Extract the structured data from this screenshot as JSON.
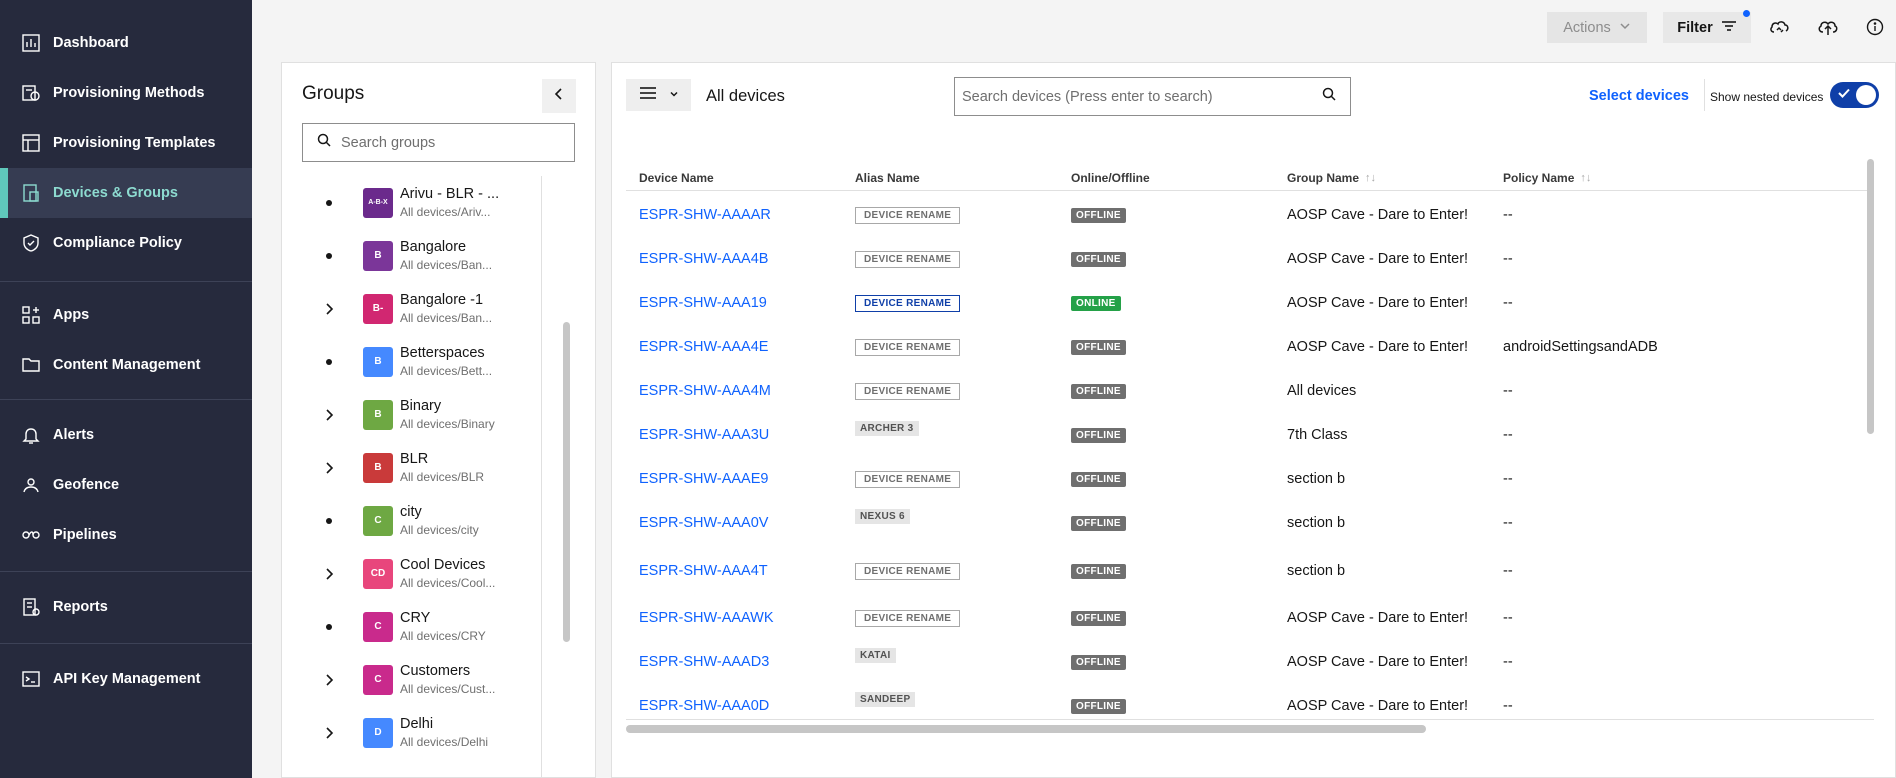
{
  "sidebar": {
    "items": [
      {
        "label": "Dashboard",
        "icon": "dashboard-icon"
      },
      {
        "label": "Provisioning Methods",
        "icon": "provisioning-methods-icon"
      },
      {
        "label": "Provisioning Templates",
        "icon": "provisioning-templates-icon"
      },
      {
        "label": "Devices & Groups",
        "icon": "devices-groups-icon",
        "active": true
      },
      {
        "label": "Compliance Policy",
        "icon": "compliance-shield-icon"
      },
      {
        "label": "Apps",
        "icon": "apps-icon"
      },
      {
        "label": "Content Management",
        "icon": "folder-icon"
      },
      {
        "label": "Alerts",
        "icon": "bell-icon"
      },
      {
        "label": "Geofence",
        "icon": "geofence-icon"
      },
      {
        "label": "Pipelines",
        "icon": "pipelines-icon"
      },
      {
        "label": "Reports",
        "icon": "reports-icon"
      },
      {
        "label": "API Key Management",
        "icon": "terminal-icon"
      }
    ],
    "accent_color": "#5fc8bb",
    "bg_color": "#262a3d"
  },
  "topbar": {
    "actions_label": "Actions",
    "filter_label": "Filter"
  },
  "groups": {
    "title": "Groups",
    "search_placeholder": "Search groups",
    "items": [
      {
        "name": "Arivu - BLR - ...",
        "path": "All devices/Ariv...",
        "avatar": "A-B-X",
        "color": "#6b2a8c",
        "expandable": false
      },
      {
        "name": "Bangalore",
        "path": "All devices/Ban...",
        "avatar": "B",
        "color": "#7b3699",
        "expandable": false
      },
      {
        "name": "Bangalore -1",
        "path": "All devices/Ban...",
        "avatar": "B-",
        "color": "#d12771",
        "expandable": true
      },
      {
        "name": "Betterspaces",
        "path": "All devices/Bett...",
        "avatar": "B",
        "color": "#4589ff",
        "expandable": false
      },
      {
        "name": "Binary",
        "path": "All devices/Binary",
        "avatar": "B",
        "color": "#6ea843",
        "expandable": true
      },
      {
        "name": "BLR",
        "path": "All devices/BLR",
        "avatar": "B",
        "color": "#c93a3a",
        "expandable": true
      },
      {
        "name": "city",
        "path": "All devices/city",
        "avatar": "C",
        "color": "#6ea843",
        "expandable": false
      },
      {
        "name": "Cool Devices",
        "path": "All devices/Cool...",
        "avatar": "CD",
        "color": "#e8467c",
        "expandable": true
      },
      {
        "name": "CRY",
        "path": "All devices/CRY",
        "avatar": "C",
        "color": "#c92a8c",
        "expandable": false
      },
      {
        "name": "Customers",
        "path": "All devices/Cust...",
        "avatar": "C",
        "color": "#c92a8c",
        "expandable": true
      },
      {
        "name": "Delhi",
        "path": "All devices/Delhi",
        "avatar": "D",
        "color": "#4589ff",
        "expandable": true
      }
    ]
  },
  "devices": {
    "title": "All devices",
    "search_placeholder": "Search devices (Press enter to search)",
    "select_label": "Select devices",
    "nested_label": "Show nested devices",
    "columns": [
      "Device Name",
      "Alias Name",
      "Online/Offline",
      "Group Name",
      "Policy Name"
    ],
    "rows": [
      {
        "name": "ESPR-SHW-AAAAR",
        "alias": "DEVICE RENAME",
        "alias_style": "tag",
        "status": "OFFLINE",
        "group": "AOSP Cave - Dare to Enter!",
        "policy": "--"
      },
      {
        "name": "ESPR-SHW-AAA4B",
        "alias": "DEVICE RENAME",
        "alias_style": "tag",
        "status": "OFFLINE",
        "group": "AOSP Cave - Dare to Enter!",
        "policy": "--"
      },
      {
        "name": "ESPR-SHW-AAA19",
        "alias": "DEVICE RENAME",
        "alias_style": "tag-hl",
        "status": "ONLINE",
        "group": "AOSP Cave - Dare to Enter!",
        "policy": "--"
      },
      {
        "name": "ESPR-SHW-AAA4E",
        "alias": "DEVICE RENAME",
        "alias_style": "tag",
        "status": "OFFLINE",
        "group": "AOSP Cave - Dare to Enter!",
        "policy": "androidSettingsandADB"
      },
      {
        "name": "ESPR-SHW-AAA4M",
        "alias": "DEVICE RENAME",
        "alias_style": "tag",
        "status": "OFFLINE",
        "group": "All devices",
        "policy": "--"
      },
      {
        "name": "ESPR-SHW-AAA3U",
        "alias": "ARCHER 3",
        "alias_style": "plain",
        "status": "OFFLINE",
        "group": "7th Class",
        "policy": "--"
      },
      {
        "name": "ESPR-SHW-AAAE9",
        "alias": "DEVICE RENAME",
        "alias_style": "tag",
        "status": "OFFLINE",
        "group": "section b",
        "policy": "--"
      },
      {
        "name": "ESPR-SHW-AAA0V",
        "alias": "NEXUS 6",
        "alias_style": "plain",
        "status": "OFFLINE",
        "group": "section b",
        "policy": "--"
      },
      {
        "name": "ESPR-SHW-AAA4T",
        "alias": "DEVICE RENAME",
        "alias_style": "tag",
        "status": "OFFLINE",
        "group": "section b",
        "policy": "--"
      },
      {
        "name": "ESPR-SHW-AAAWK",
        "alias": "DEVICE RENAME",
        "alias_style": "tag",
        "status": "OFFLINE",
        "group": "AOSP Cave - Dare to Enter!",
        "policy": "--"
      },
      {
        "name": "ESPR-SHW-AAAD3",
        "alias": "KATAI",
        "alias_style": "plain",
        "status": "OFFLINE",
        "group": "AOSP Cave - Dare to Enter!",
        "policy": "--"
      },
      {
        "name": "ESPR-SHW-AAA0D",
        "alias": "SANDEEP",
        "alias_style": "plain",
        "status": "OFFLINE",
        "group": "AOSP Cave - Dare to Enter!",
        "policy": "--"
      }
    ]
  }
}
